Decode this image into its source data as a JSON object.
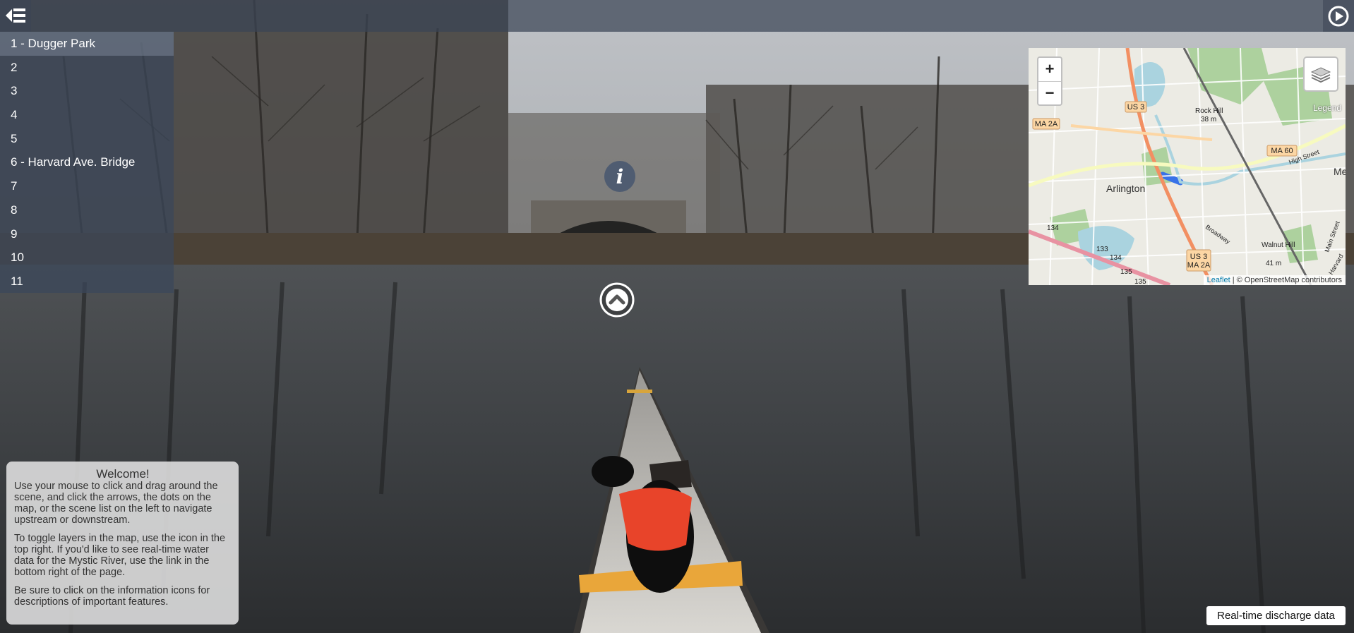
{
  "toolbar": {
    "menu_icon": "list-collapse-icon",
    "autorotate_icon": "play-circle-icon"
  },
  "scenes": [
    {
      "label": "1 - Dugger Park",
      "active": true
    },
    {
      "label": "2"
    },
    {
      "label": "3"
    },
    {
      "label": "4"
    },
    {
      "label": "5"
    },
    {
      "label": "6 - Harvard Ave. Bridge"
    },
    {
      "label": "7"
    },
    {
      "label": "8"
    },
    {
      "label": "9"
    },
    {
      "label": "10"
    },
    {
      "label": "11"
    }
  ],
  "map": {
    "zoom_in": "+",
    "zoom_out": "−",
    "legend": "Legend",
    "places": {
      "arlington": "Arlington",
      "rock_hill": "Rock Hill",
      "rock_hill_elev": "38 m",
      "walnut_hill": "Walnut Hill",
      "walnut_hill_elev": "41 m",
      "me": "Me",
      "broadway": "Broadway",
      "high_street": "High Street",
      "main_street": "Main Street",
      "harvard": "Harvard"
    },
    "shields": {
      "us3_top": "US 3",
      "ma2a_left": "MA 2A",
      "ma60": "MA 60",
      "us3_bottom": "US 3",
      "ma2a_bottom": "MA 2A"
    },
    "route_numbers": {
      "r134_a": "134",
      "r133": "133",
      "r134_b": "134",
      "r135_a": "135",
      "r135_b": "135"
    },
    "attribution_link": "Leaflet",
    "attribution_text": "| © OpenStreetMap contributors"
  },
  "hotspots": {
    "info_icon": "info-icon",
    "nav_icon": "chevron-up-icon"
  },
  "welcome": {
    "title": "Welcome!",
    "p1": "Use your mouse to click and drag around the scene, and click the arrows, the dots on the map, or the scene list on the left to navigate upstream or downstream.",
    "p2": "To toggle layers in the map, use the icon in the top right. If you'd like to see real-time water data for the Mystic River, use the link in the bottom right of the page.",
    "p3": "Be sure to click on the information icons for descriptions of important features."
  },
  "discharge_link": "Real-time discharge data",
  "colors": {
    "panel": "#3a465a",
    "water_map": "#aad3df",
    "park_map": "#add19e",
    "vest": "#e8442a",
    "canoe": "#d8d6d0"
  }
}
